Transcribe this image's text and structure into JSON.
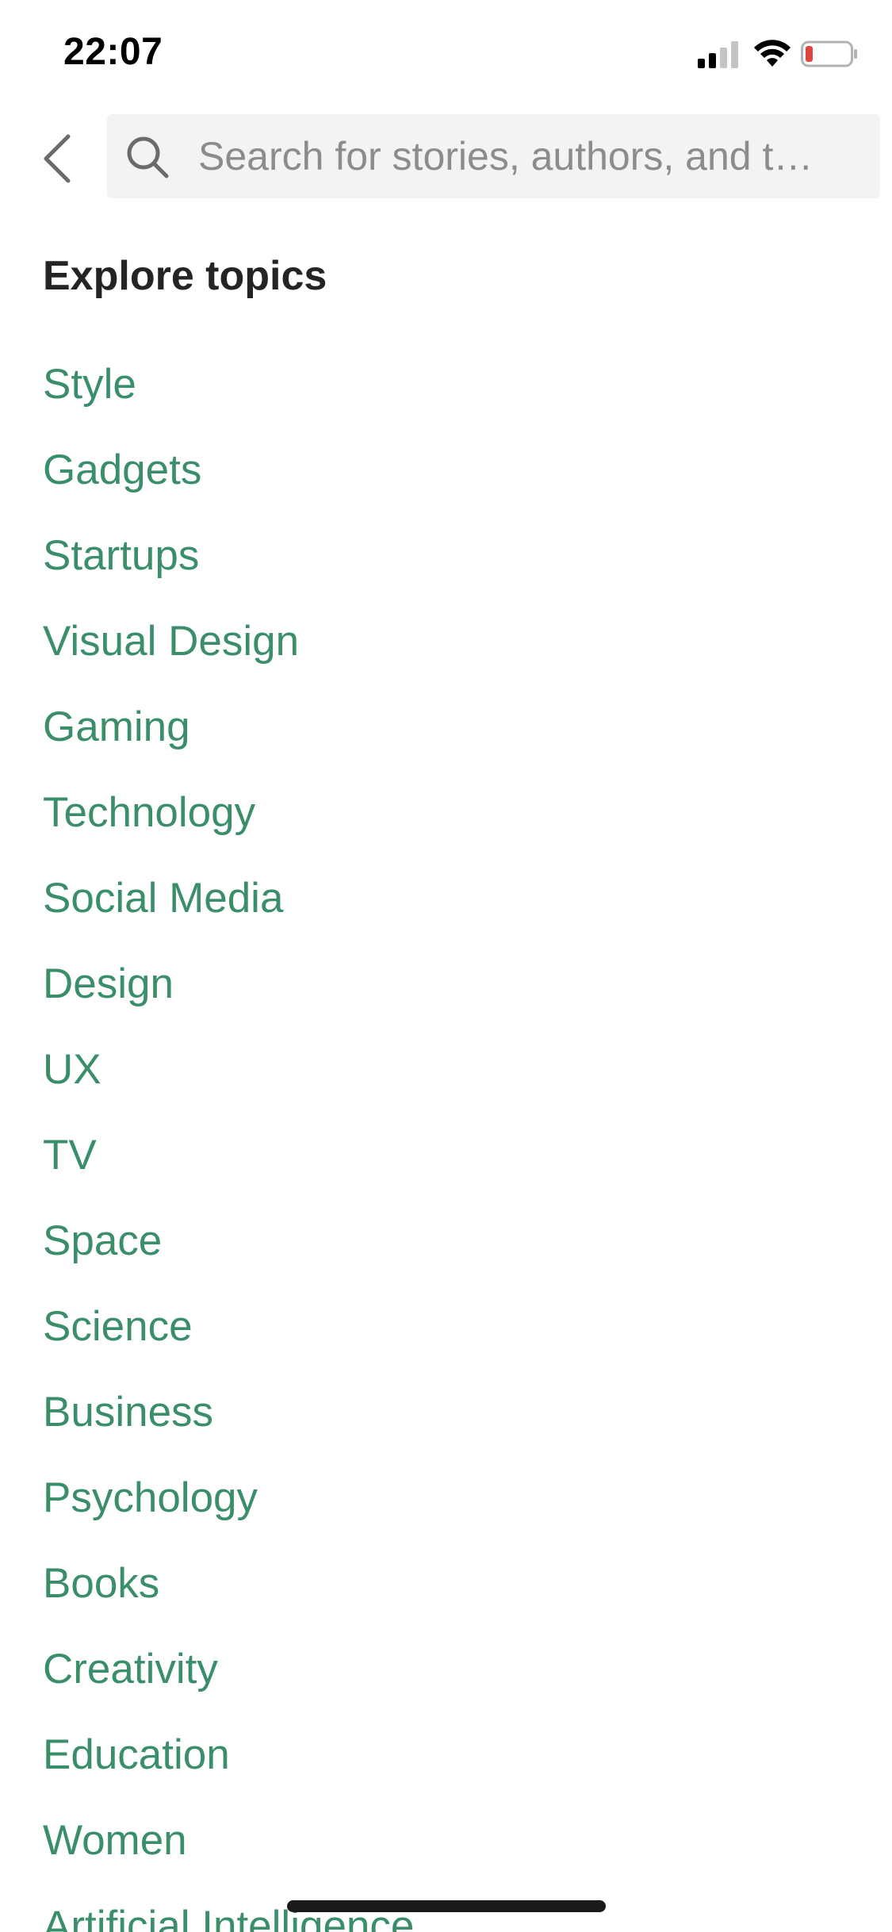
{
  "status_bar": {
    "time": "22:07",
    "signal_icon": "cellular-signal-icon",
    "wifi_icon": "wifi-icon",
    "battery_icon": "battery-low-icon",
    "battery_color": "#e0443e"
  },
  "header": {
    "back_icon": "chevron-left-icon",
    "search": {
      "placeholder": "Search for stories, authors, and t…",
      "value": "",
      "icon": "search-icon"
    }
  },
  "section": {
    "title": "Explore topics"
  },
  "topics": [
    {
      "label": "Style"
    },
    {
      "label": "Gadgets"
    },
    {
      "label": "Startups"
    },
    {
      "label": "Visual Design"
    },
    {
      "label": "Gaming"
    },
    {
      "label": "Technology"
    },
    {
      "label": "Social Media"
    },
    {
      "label": "Design"
    },
    {
      "label": "UX"
    },
    {
      "label": "TV"
    },
    {
      "label": "Space"
    },
    {
      "label": "Science"
    },
    {
      "label": "Business"
    },
    {
      "label": "Psychology"
    },
    {
      "label": "Books"
    },
    {
      "label": "Creativity"
    },
    {
      "label": "Education"
    },
    {
      "label": "Women"
    },
    {
      "label": "Artificial Intelligence"
    }
  ],
  "colors": {
    "accent": "#3b8e6a",
    "heading": "#242424",
    "search_bg": "#f3f3f3",
    "placeholder": "#8c8c8c"
  }
}
